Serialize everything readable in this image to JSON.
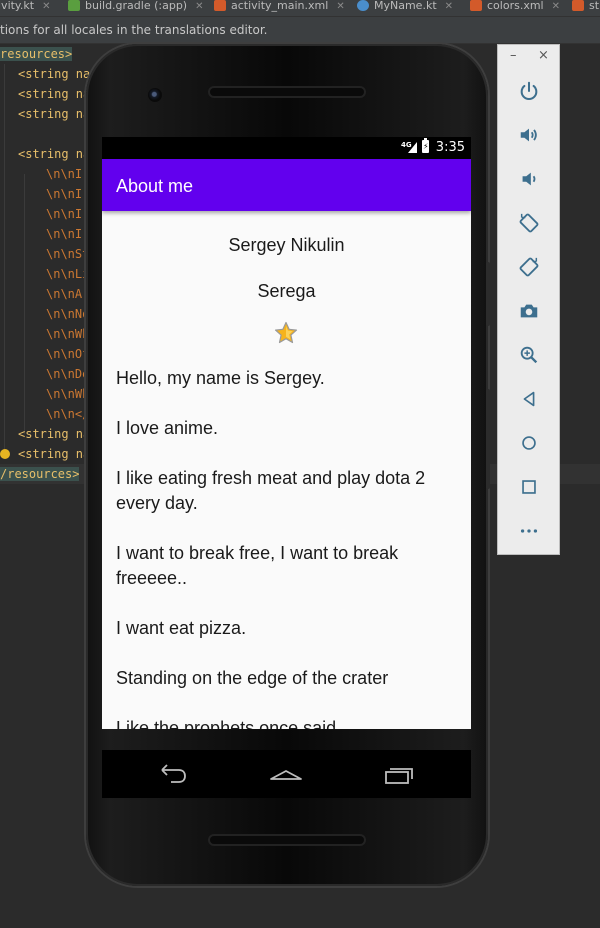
{
  "ide": {
    "tabs": [
      {
        "label": "ivity.kt",
        "icon": "kotlin-file-icon",
        "icon_color": "#e37933"
      },
      {
        "label": "build.gradle (:app)",
        "icon": "gradle-file-icon",
        "icon_color": "#5a9e3f"
      },
      {
        "label": "activity_main.xml",
        "icon": "layout-xml-icon",
        "icon_color": "#d35a2a"
      },
      {
        "label": "MyName.kt",
        "icon": "kotlin-class-icon",
        "icon_color": "#4a8ecc"
      },
      {
        "label": "colors.xml",
        "icon": "values-xml-icon",
        "icon_color": "#d35a2a"
      },
      {
        "label": "st",
        "icon": "values-xml-icon",
        "icon_color": "#d35a2a"
      }
    ],
    "notice": "tions for all locales in the translations editor.",
    "code_lines": [
      {
        "text": "resources>"
      },
      {
        "text": "<string na"
      },
      {
        "text": "<string na"
      },
      {
        "text": "<string na"
      },
      {
        "text": ""
      },
      {
        "text": "<string na"
      },
      {
        "text": "\\n\\nI "
      },
      {
        "text": "\\n\\nI "
      },
      {
        "text": "\\n\\nI "
      },
      {
        "text": "\\n\\nI "
      },
      {
        "text": "\\n\\nSt"
      },
      {
        "text": "\\n\\nLi"
      },
      {
        "text": "\\n\\nAr"
      },
      {
        "text": "\\n\\nNo"
      },
      {
        "text": "\\n\\nWh"
      },
      {
        "text": "\\n\\nOf"
      },
      {
        "text": "\\n\\nDe"
      },
      {
        "text": "\\n\\nWh"
      },
      {
        "text": "\\n\\n</"
      },
      {
        "text": "<string na"
      },
      {
        "text": "<string na"
      },
      {
        "text": "/resources>"
      }
    ]
  },
  "device": {
    "status": {
      "network": "4G",
      "time": "3:35"
    },
    "app_bar_title": "About me",
    "name": "Sergey Nikulin",
    "nickname": "Serega",
    "bio": "Hello, my name is Sergey.\n\nI love anime.\n\nI like eating fresh meat and play dota 2 every day.\n\nI want to break free, I want to break freeeee..\n\nI want eat pizza.\n\nStanding on the edge of the crater\n\nLike the prophets once said",
    "nav": [
      "back-icon",
      "home-icon",
      "recents-icon"
    ],
    "colors": {
      "primary": "#6200ee",
      "star_fill": "#f6b31c",
      "star_outline": "#b0b0b0"
    }
  },
  "emulator_toolbar": {
    "window_controls": [
      "–",
      "×"
    ],
    "buttons": [
      "power-icon",
      "volume-up-icon",
      "volume-down-icon",
      "rotate-left-icon",
      "rotate-right-icon",
      "camera-icon",
      "zoom-icon",
      "back-icon",
      "home-icon",
      "overview-icon",
      "more-icon"
    ]
  }
}
